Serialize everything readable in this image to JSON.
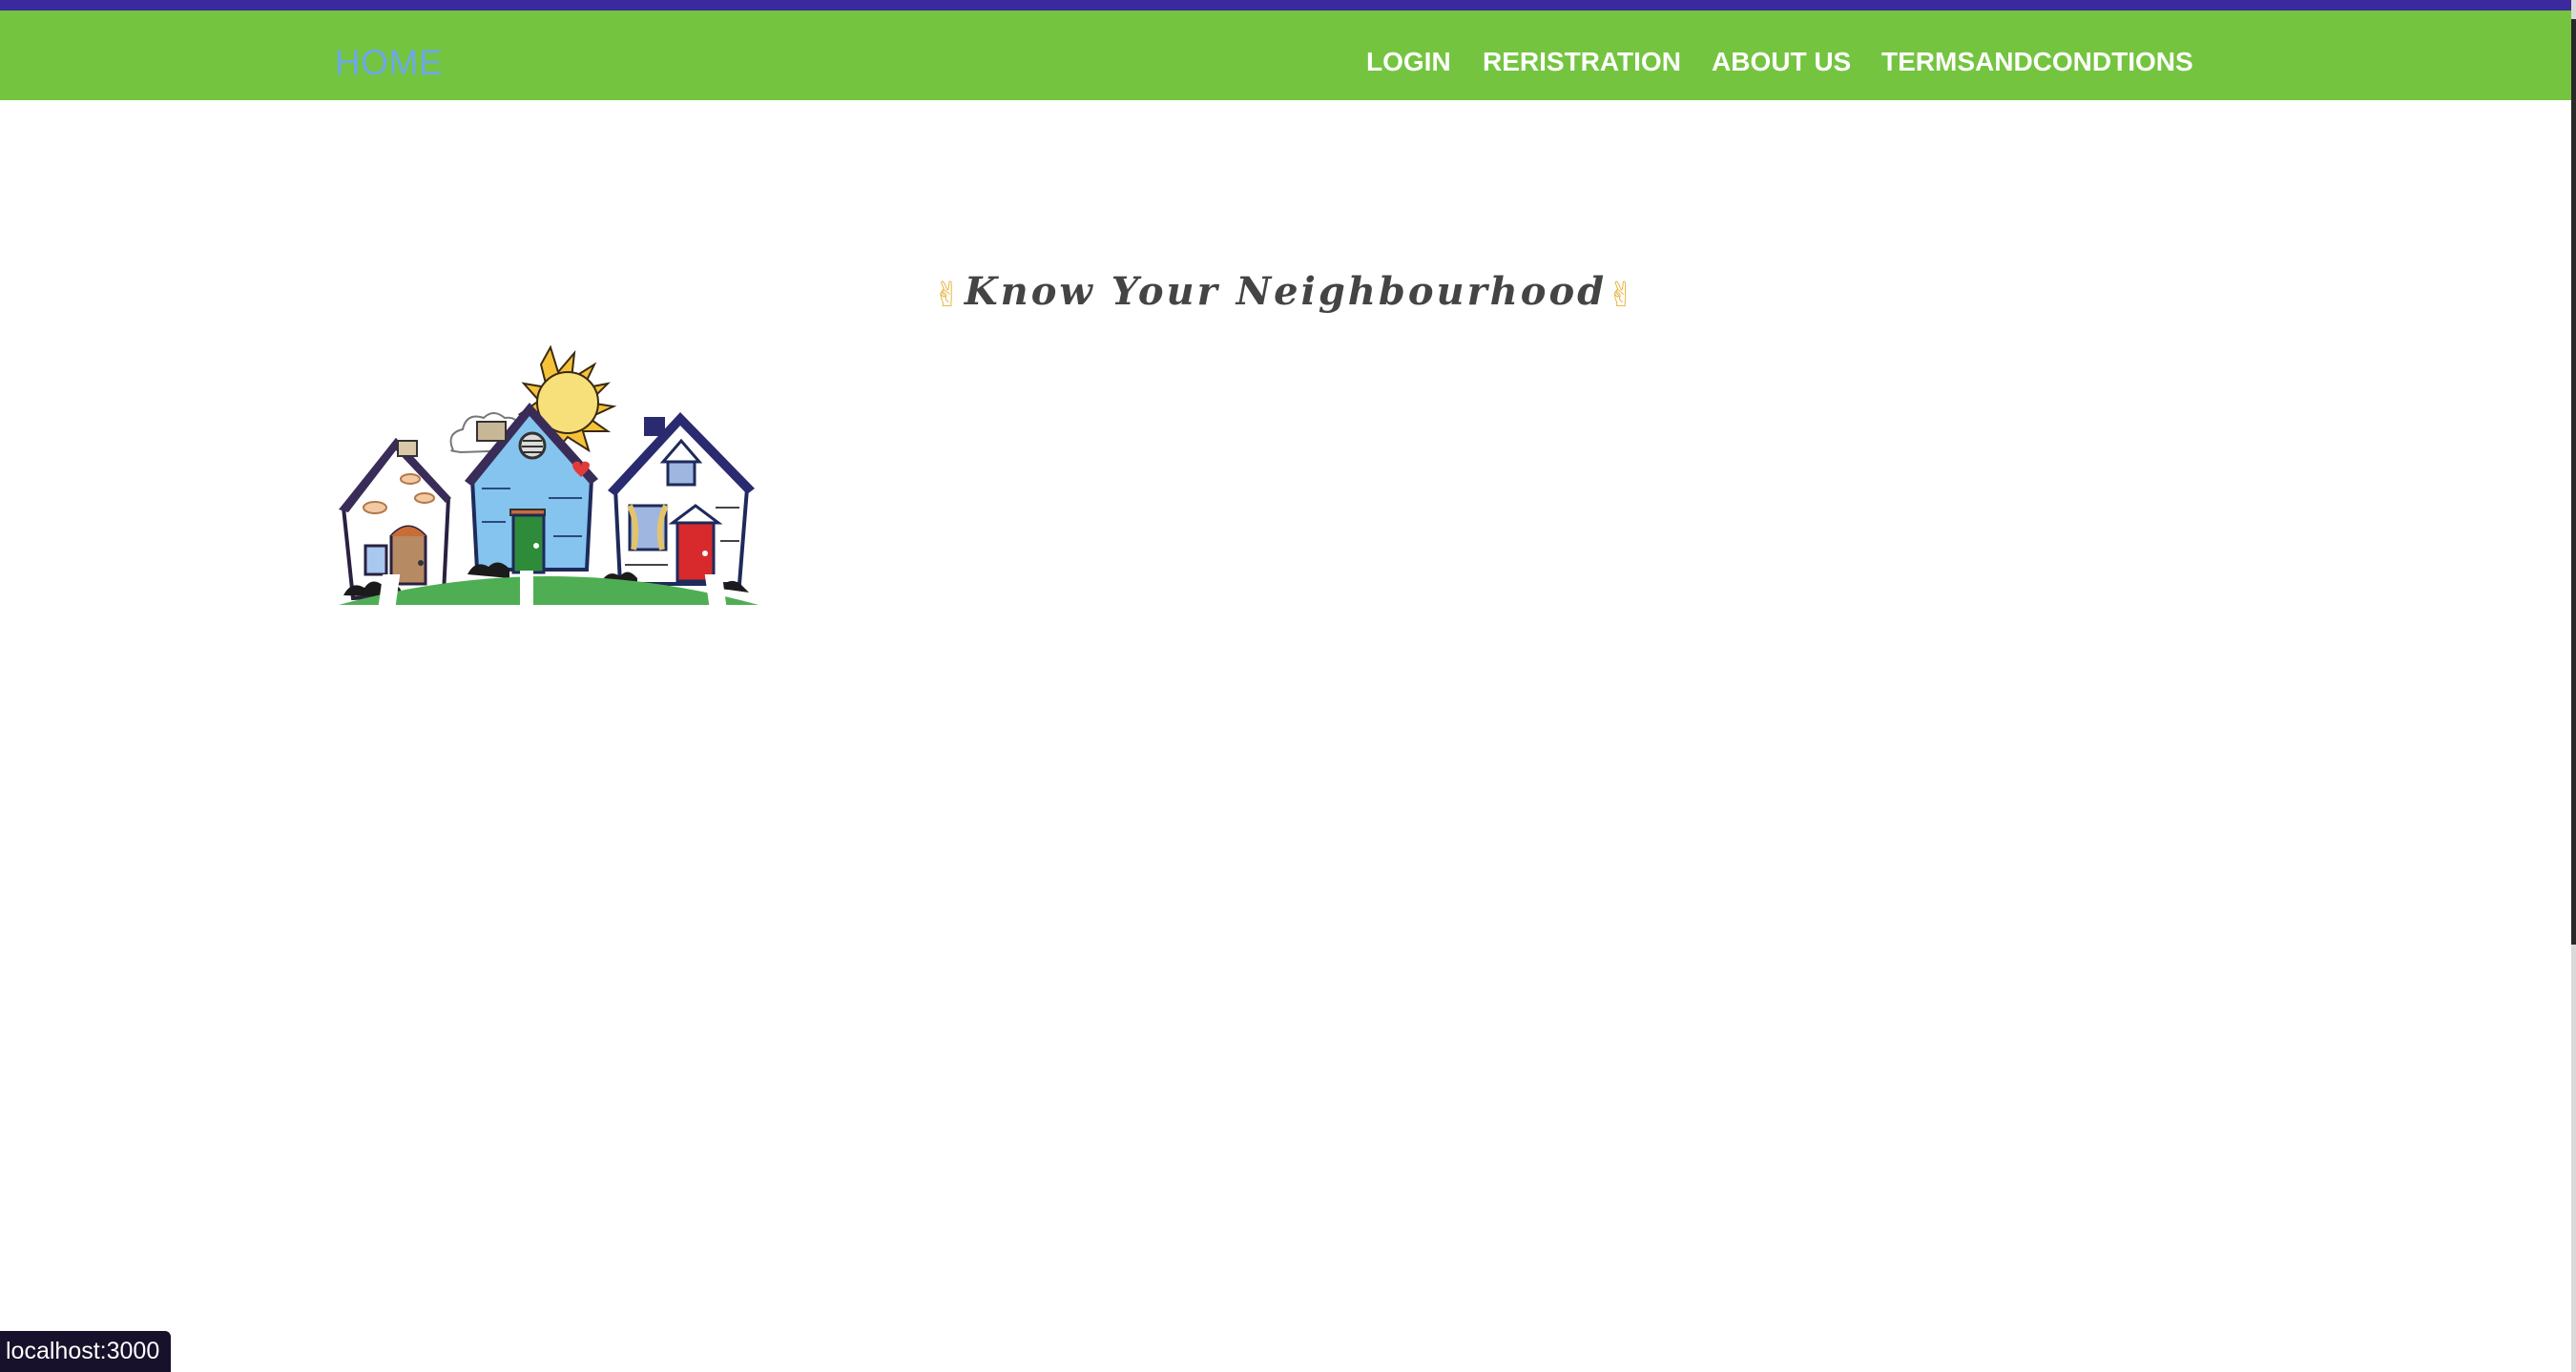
{
  "navbar": {
    "home_label": "HOME",
    "links": [
      {
        "label": "LOGIN"
      },
      {
        "label": "RERISTRATION"
      },
      {
        "label": "ABOUT US"
      },
      {
        "label": "TERMSANDCONDTIONS"
      }
    ]
  },
  "hero": {
    "title": "Know Your Neighbourhood",
    "left_icon": "victory-hand-icon",
    "right_icon": "victory-hand-icon"
  },
  "illustration": {
    "name": "neighbourhood-houses-illustration"
  },
  "status_bar": {
    "url": "localhost:3000"
  },
  "colors": {
    "navbar_bg": "#74c440",
    "top_accent": "#3b2a9e",
    "home_link": "#6ea8e6",
    "nav_link": "#ffffff",
    "title_text": "#444444"
  }
}
